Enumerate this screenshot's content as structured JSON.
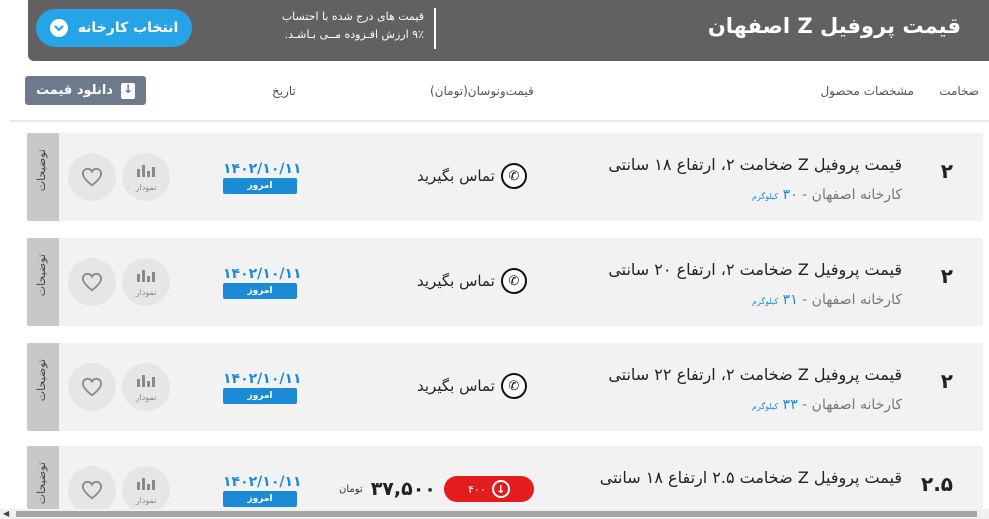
{
  "header": {
    "title": "قیمت پروفیل Z اصفهان",
    "note_line1": "قیمت های درج شده با احتساب",
    "note_line2": "۹٪ ارزش افـزوده مــی بـاشـد.",
    "factory_button": "انتخاب کارخانه"
  },
  "columns": {
    "thickness": "ضخامت",
    "specs": "مشخصات محصول",
    "price": "قیمت‌ونوسان(تومان)",
    "date": "تاریخ",
    "download": "دانلود قیمت"
  },
  "rows": [
    {
      "thickness": "۲",
      "name": "قیمت پروفیل Z ضخامت ۲، ارتفاع ۱۸ سانتی",
      "factory": "کارخانه اصفهان - ",
      "weight": "۳۰",
      "weight_unit": "کیلوگرم",
      "call": "تماس بگیرید",
      "date": "۱۴۰۲/۱۰/۱۱",
      "today": "امروز",
      "chart_label": "نمودار",
      "desc_tab": "توضیحات"
    },
    {
      "thickness": "۲",
      "name": "قیمت پروفیل Z ضخامت ۲، ارتفاع ۲۰ سانتی",
      "factory": "کارخانه اصفهان - ",
      "weight": "۳۱",
      "weight_unit": "کیلوگرم",
      "call": "تماس بگیرید",
      "date": "۱۴۰۲/۱۰/۱۱",
      "today": "امروز",
      "chart_label": "نمودار",
      "desc_tab": "توضیحات"
    },
    {
      "thickness": "۲",
      "name": "قیمت پروفیل Z ضخامت ۲، ارتفاع ۲۲ سانتی",
      "factory": "کارخانه اصفهان - ",
      "weight": "۳۳",
      "weight_unit": "کیلوگرم",
      "call": "تماس بگیرید",
      "date": "۱۴۰۲/۱۰/۱۱",
      "today": "امروز",
      "chart_label": "نمودار",
      "desc_tab": "توضیحات"
    },
    {
      "thickness": "۲.۵",
      "name": "قیمت پروفیل Z ضخامت ۲.۵ ارتفاع ۱۸ سانتی",
      "price": "۳۷,۵۰۰",
      "currency": "تومان",
      "change": "۴۰۰",
      "date": "۱۴۰۲/۱۰/۱۱",
      "today": "امروز",
      "chart_label": "نمودار",
      "desc_tab": "توضیحات"
    }
  ],
  "colors": {
    "header_bg": "#616161",
    "accent_blue": "#1c8bd6",
    "factory_button": "#27a3e8",
    "download_button": "#6c7a8c",
    "price_down": "#e31d1d",
    "row_bg": "#f2f2f2"
  },
  "icons": {
    "factory_button": "chevron-down-icon",
    "download": "download-icon",
    "call": "phone-icon",
    "favorite": "heart-icon",
    "chart": "bar-chart-icon",
    "change": "arrow-down-circle-icon"
  }
}
